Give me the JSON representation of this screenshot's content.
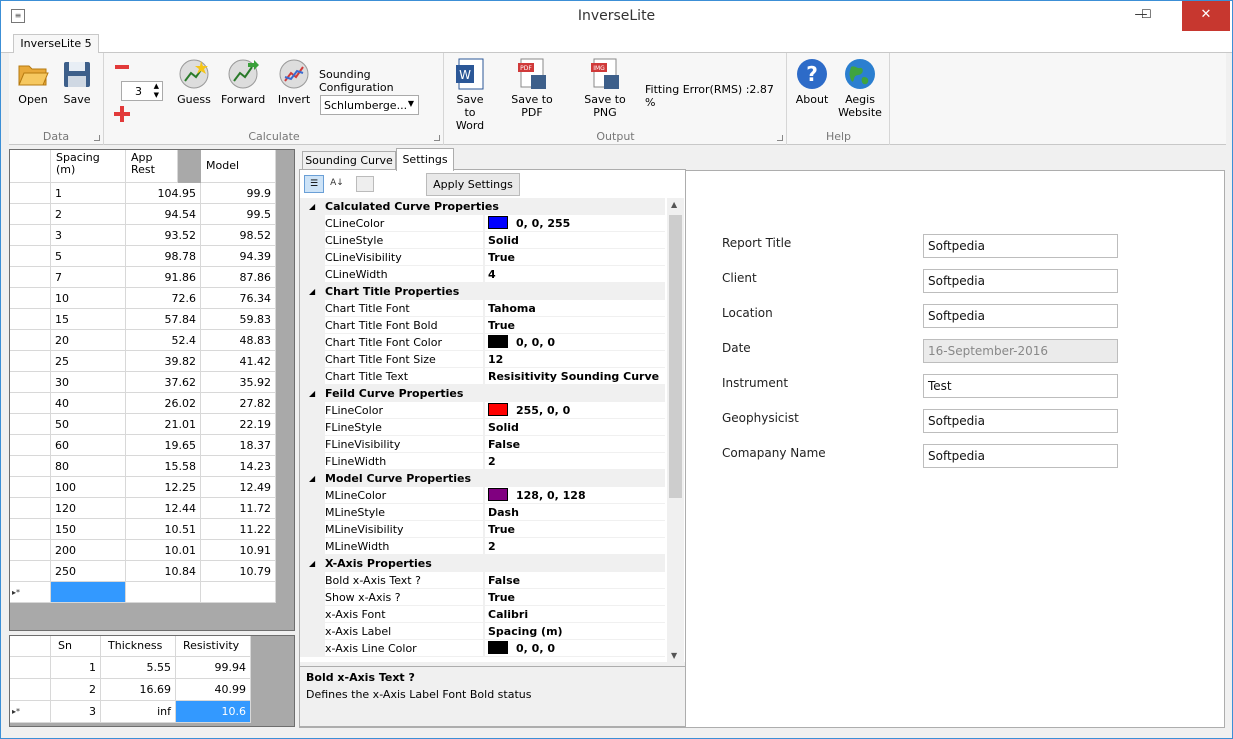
{
  "window": {
    "title": "InverseLite",
    "minimize": "—",
    "maximize": "☐",
    "close": "✕"
  },
  "ribbon": {
    "tab": "InverseLite 5",
    "groups": {
      "data": "Data",
      "calculate": "Calculate",
      "output": "Output",
      "help": "Help"
    },
    "buttons": {
      "open": "Open",
      "save": "Save",
      "guess": "Guess",
      "forward": "Forward",
      "invert": "Invert",
      "save_word": "Save to Word",
      "save_pdf": "Save to PDF",
      "save_png": "Save to PNG",
      "about": "About",
      "aegis": "Aegis Website"
    },
    "layers_value": "3",
    "sounding_config_label": "Sounding Configuration",
    "sounding_config_value": "Schlumberge...",
    "fitting_error": "Fitting Error(RMS) :2.87 %"
  },
  "data_grid": {
    "headers": [
      "Spacing (m)",
      "App Rest",
      "Model"
    ],
    "rows": [
      [
        "1",
        "104.95",
        "99.9"
      ],
      [
        "2",
        "94.54",
        "99.5"
      ],
      [
        "3",
        "93.52",
        "98.52"
      ],
      [
        "5",
        "98.78",
        "94.39"
      ],
      [
        "7",
        "91.86",
        "87.86"
      ],
      [
        "10",
        "72.6",
        "76.34"
      ],
      [
        "15",
        "57.84",
        "59.83"
      ],
      [
        "20",
        "52.4",
        "48.83"
      ],
      [
        "25",
        "39.82",
        "41.42"
      ],
      [
        "30",
        "37.62",
        "35.92"
      ],
      [
        "40",
        "26.02",
        "27.82"
      ],
      [
        "50",
        "21.01",
        "22.19"
      ],
      [
        "60",
        "19.65",
        "18.37"
      ],
      [
        "80",
        "15.58",
        "14.23"
      ],
      [
        "100",
        "12.25",
        "12.49"
      ],
      [
        "120",
        "12.44",
        "11.72"
      ],
      [
        "150",
        "10.51",
        "11.22"
      ],
      [
        "200",
        "10.01",
        "10.91"
      ],
      [
        "250",
        "10.84",
        "10.79"
      ]
    ],
    "new_row_marker": "▸*"
  },
  "layer_grid": {
    "headers": [
      "Sn",
      "Thickness",
      "Resistivity"
    ],
    "rows": [
      [
        "1",
        "5.55",
        "99.94"
      ],
      [
        "2",
        "16.69",
        "40.99"
      ],
      [
        "3",
        "inf",
        "10.6"
      ]
    ],
    "new_row_marker": "▸*"
  },
  "tabs": {
    "sounding": "Sounding Curve",
    "settings": "Settings"
  },
  "apply_settings": "Apply Settings",
  "properties": [
    {
      "type": "cat",
      "name": "Calculated Curve Properties"
    },
    {
      "type": "prop",
      "name": "CLineColor",
      "value": "0, 0, 255",
      "color": "#0000ff"
    },
    {
      "type": "prop",
      "name": "CLineStyle",
      "value": "Solid"
    },
    {
      "type": "prop",
      "name": "CLineVisibility",
      "value": "True"
    },
    {
      "type": "prop",
      "name": "CLineWidth",
      "value": "4"
    },
    {
      "type": "cat",
      "name": "Chart Title Properties"
    },
    {
      "type": "prop",
      "name": "Chart Title Font",
      "value": "Tahoma"
    },
    {
      "type": "prop",
      "name": "Chart Title Font Bold",
      "value": "True"
    },
    {
      "type": "prop",
      "name": "Chart Title Font Color",
      "value": "0, 0, 0",
      "color": "#000000"
    },
    {
      "type": "prop",
      "name": "Chart Title Font Size",
      "value": "12"
    },
    {
      "type": "prop",
      "name": "Chart Title Text",
      "value": "Resisitivity Sounding Curve"
    },
    {
      "type": "cat",
      "name": "Feild Curve Properties"
    },
    {
      "type": "prop",
      "name": "FLineColor",
      "value": "255, 0, 0",
      "color": "#ff0000"
    },
    {
      "type": "prop",
      "name": "FLineStyle",
      "value": "Solid"
    },
    {
      "type": "prop",
      "name": "FLineVisibility",
      "value": "False"
    },
    {
      "type": "prop",
      "name": "FLineWidth",
      "value": "2"
    },
    {
      "type": "cat",
      "name": "Model Curve Properties"
    },
    {
      "type": "prop",
      "name": "MLineColor",
      "value": "128, 0, 128",
      "color": "#800080"
    },
    {
      "type": "prop",
      "name": "MLineStyle",
      "value": "Dash"
    },
    {
      "type": "prop",
      "name": "MLineVisibility",
      "value": "True"
    },
    {
      "type": "prop",
      "name": "MLineWidth",
      "value": "2"
    },
    {
      "type": "cat",
      "name": "X-Axis Properties"
    },
    {
      "type": "prop",
      "name": "Bold x-Axis Text ?",
      "value": "False"
    },
    {
      "type": "prop",
      "name": "Show x-Axis ?",
      "value": "True"
    },
    {
      "type": "prop",
      "name": "x-Axis Font",
      "value": "Calibri"
    },
    {
      "type": "prop",
      "name": "x-Axis Label",
      "value": "Spacing (m)"
    },
    {
      "type": "prop",
      "name": "x-Axis Line Color",
      "value": "0, 0, 0",
      "color": "#000000"
    }
  ],
  "description": {
    "title": "Bold x-Axis Text ?",
    "text": "Defines the x-Axis Label Font Bold status"
  },
  "report_fields": [
    {
      "label": "Report Title",
      "value": "Softpedia",
      "disabled": false
    },
    {
      "label": "Client",
      "value": "Softpedia",
      "disabled": false
    },
    {
      "label": "Location",
      "value": "Softpedia",
      "disabled": false
    },
    {
      "label": "Date",
      "value": "16-September-2016",
      "disabled": true
    },
    {
      "label": "Instrument",
      "value": "Test",
      "disabled": false
    },
    {
      "label": "Geophysicist",
      "value": "Softpedia",
      "disabled": false
    },
    {
      "label": "Comapany Name",
      "value": "Softpedia",
      "disabled": false
    }
  ]
}
